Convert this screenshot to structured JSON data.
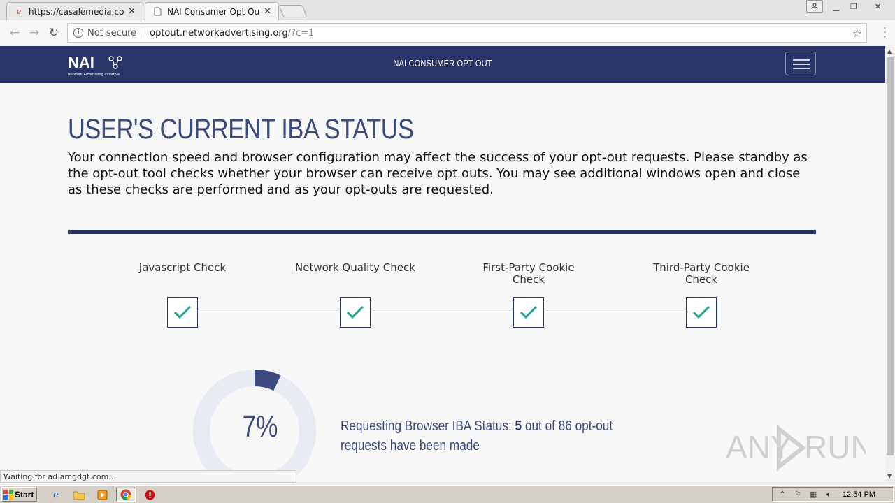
{
  "browser": {
    "tabs": [
      {
        "title": "https://casalemedia.com",
        "favicon": "page-e-icon",
        "active": false
      },
      {
        "title": "NAI Consumer Opt Out",
        "favicon": "page-icon",
        "active": true
      }
    ],
    "address": {
      "security": "Not secure",
      "host": "optout.networkadvertising.org",
      "path": "/?c=1"
    },
    "status_bubble": "Waiting for ad.amgdgt.com..."
  },
  "site": {
    "logo_text": "NAI",
    "logo_subtext": "Network Advertising Initiative",
    "nav_title": "NAI CONSUMER OPT OUT"
  },
  "content": {
    "heading": "USER'S CURRENT IBA STATUS",
    "intro": "Your connection speed and browser configuration may affect the success of your opt-out requests. Please standby as the opt-out tool checks whether your browser can receive opt outs. You may see additional windows open and close as these checks are performed and as your opt-outs are requested.",
    "steps": [
      {
        "label": "Javascript Check",
        "status": "complete"
      },
      {
        "label": "Network Quality Check",
        "status": "complete"
      },
      {
        "label": "First-Party Cookie Check",
        "status": "complete"
      },
      {
        "label": "Third-Party Cookie Check",
        "status": "complete"
      }
    ],
    "progress": {
      "percent_label": "7%",
      "fraction": 0.07,
      "status_prefix": "Requesting Browser IBA Status: ",
      "done": "5",
      "status_suffix": " out of 86 opt-out requests have been made"
    }
  },
  "watermark": {
    "left": "ANY",
    "right": "RUN"
  },
  "taskbar": {
    "start_label": "Start",
    "clock": "12:54 PM"
  },
  "colors": {
    "brand_navy": "#2b3466",
    "accent_teal": "#1fa58f",
    "ring_track": "#e9ebf3"
  }
}
